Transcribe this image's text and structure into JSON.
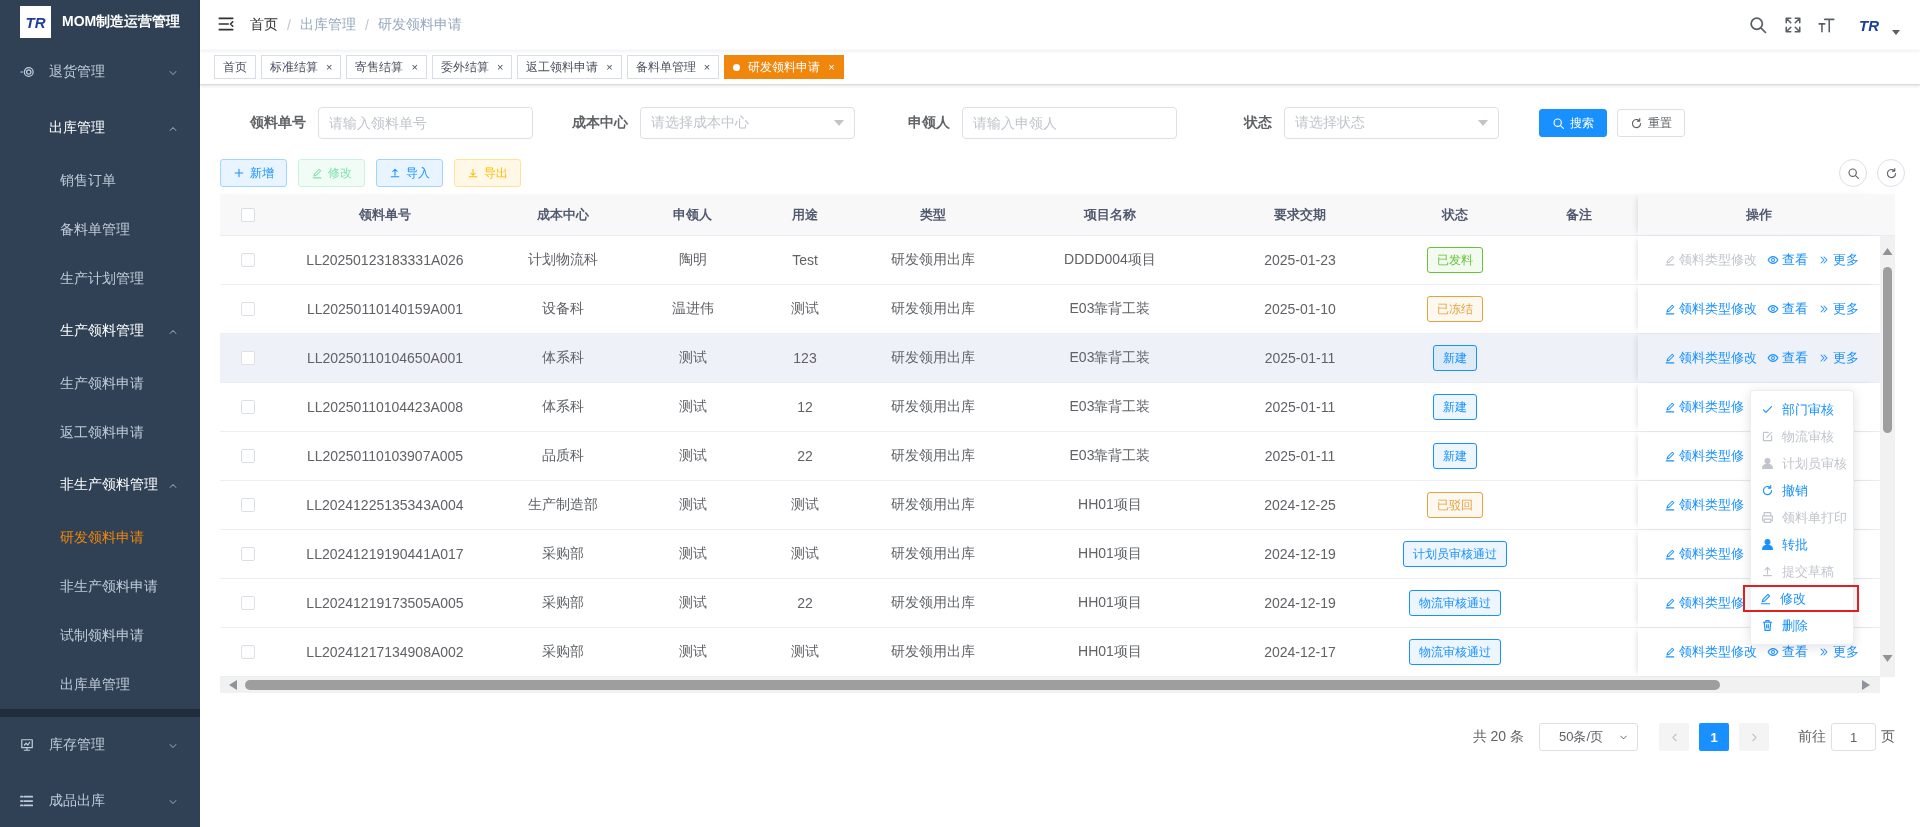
{
  "sidebar": {
    "logo_text": "TR",
    "title": "MOM制造运营管理",
    "items": [
      {
        "label": "退货管理",
        "expanded": false
      },
      {
        "label": "出库管理",
        "expanded": true,
        "children": [
          {
            "label": "销售订单",
            "selected": false
          },
          {
            "label": "备料单管理",
            "selected": false
          },
          {
            "label": "生产计划管理",
            "selected": false
          },
          {
            "label": "生产领料管理",
            "expanded": true,
            "children": [
              {
                "label": "生产领料申请",
                "selected": false
              },
              {
                "label": "返工领料申请",
                "selected": false
              }
            ]
          },
          {
            "label": "非生产领料管理",
            "expanded": true,
            "children": [
              {
                "label": "研发领料申请",
                "selected": true
              },
              {
                "label": "非生产领料申请",
                "selected": false
              },
              {
                "label": "试制领料申请",
                "selected": false
              }
            ]
          },
          {
            "label": "出库单管理",
            "selected": false
          }
        ]
      },
      {
        "label": "库存管理",
        "expanded": false
      },
      {
        "label": "成品出库",
        "expanded": false
      }
    ]
  },
  "header": {
    "breadcrumb": {
      "separator": "/",
      "items": [
        {
          "label": "首页",
          "clickable": true
        },
        {
          "label": "出库管理",
          "clickable": false
        },
        {
          "label": "研发领料申请",
          "clickable": false
        }
      ]
    },
    "avatar_text": "TR"
  },
  "tabs": [
    {
      "label": "首页",
      "selected": false
    },
    {
      "label": "标准结算",
      "selected": false,
      "close_mark": "×"
    },
    {
      "label": "寄售结算",
      "selected": false,
      "close_mark": "×"
    },
    {
      "label": "委外结算",
      "selected": false,
      "close_mark": "×"
    },
    {
      "label": "返工领料申请",
      "selected": false,
      "close_mark": "×"
    },
    {
      "label": "备料单管理",
      "selected": false,
      "close_mark": "×"
    },
    {
      "label": "研发领料申请",
      "selected": true,
      "close_mark": "×"
    }
  ],
  "filters": {
    "fields": [
      {
        "label": "领料单号",
        "placeholder": "请输入领料单号",
        "kind": "input"
      },
      {
        "label": "成本中心",
        "placeholder": "请选择成本中心",
        "kind": "select"
      },
      {
        "label": "申领人",
        "placeholder": "请输入申领人",
        "kind": "input"
      },
      {
        "label": "状态",
        "placeholder": "请选择状态",
        "kind": "select"
      }
    ],
    "buttons": [
      {
        "label": "搜索",
        "kind": "primary"
      },
      {
        "label": "重置",
        "kind": "default"
      }
    ]
  },
  "toolbar": [
    {
      "label": "新增",
      "kind": "primary",
      "disabled": false
    },
    {
      "label": "修改",
      "kind": "success",
      "disabled": true
    },
    {
      "label": "导入",
      "kind": "info",
      "disabled": false
    },
    {
      "label": "导出",
      "kind": "warning",
      "disabled": false
    }
  ],
  "table": {
    "all_checked": false,
    "columns": [
      "领料单号",
      "成本中心",
      "申领人",
      "用途",
      "类型",
      "项目名称",
      "要求交期",
      "状态",
      "备注",
      "操作"
    ],
    "rows": [
      {
        "checked": false,
        "hovered": false,
        "cells": [
          "LL20250123183331A026",
          "计划物流科",
          "陶明",
          "Test",
          "研发领用出库",
          "DDDD004项目",
          "2025-01-23"
        ],
        "status": "已发料",
        "color": "#67c23a",
        "actions": [
          {
            "label": "领料类型修改",
            "disabled": true
          },
          {
            "label": "查看",
            "disabled": false
          },
          {
            "label": "更多",
            "disabled": false
          }
        ]
      },
      {
        "checked": false,
        "hovered": false,
        "cells": [
          "LL20250110140159A001",
          "设备科",
          "温进伟",
          "测试",
          "研发领用出库",
          "E03靠背工装",
          "2025-01-10"
        ],
        "status": "已冻结",
        "color": "#e6a23c",
        "actions": [
          {
            "label": "领料类型修改",
            "disabled": false
          },
          {
            "label": "查看",
            "disabled": false
          },
          {
            "label": "更多",
            "disabled": false
          }
        ]
      },
      {
        "checked": false,
        "hovered": true,
        "cells": [
          "LL20250110104650A001",
          "体系科",
          "测试",
          "123",
          "研发领用出库",
          "E03靠背工装",
          "2025-01-11"
        ],
        "status": "新建",
        "color": "#1890ff",
        "actions": [
          {
            "label": "领料类型修改",
            "disabled": false
          },
          {
            "label": "查看",
            "disabled": false
          },
          {
            "label": "更多",
            "disabled": false
          }
        ]
      },
      {
        "checked": false,
        "hovered": false,
        "cells": [
          "LL20250110104423A008",
          "体系科",
          "测试",
          "12",
          "研发领用出库",
          "E03靠背工装",
          "2025-01-11"
        ],
        "status": "新建",
        "color": "#1890ff",
        "actions": [
          {
            "label": "领料类型修",
            "disabled": false
          }
        ]
      },
      {
        "checked": false,
        "hovered": false,
        "cells": [
          "LL20250110103907A005",
          "品质科",
          "测试",
          "22",
          "研发领用出库",
          "E03靠背工装",
          "2025-01-11"
        ],
        "status": "新建",
        "color": "#1890ff",
        "actions": [
          {
            "label": "领料类型修",
            "disabled": false
          }
        ]
      },
      {
        "checked": false,
        "hovered": false,
        "cells": [
          "LL20241225135343A004",
          "生产制造部",
          "测试",
          "测试",
          "研发领用出库",
          "HH01项目",
          "2024-12-25"
        ],
        "status": "已驳回",
        "color": "#e6a23c",
        "actions": [
          {
            "label": "领料类型修",
            "disabled": false
          }
        ]
      },
      {
        "checked": false,
        "hovered": false,
        "cells": [
          "LL20241219190441A017",
          "采购部",
          "测试",
          "测试",
          "研发领用出库",
          "HH01项目",
          "2024-12-19"
        ],
        "status": "计划员审核通过",
        "color": "#1890ff",
        "actions": [
          {
            "label": "领料类型修",
            "disabled": false
          }
        ]
      },
      {
        "checked": false,
        "hovered": false,
        "cells": [
          "LL20241219173505A005",
          "采购部",
          "测试",
          "22",
          "研发领用出库",
          "HH01项目",
          "2024-12-19"
        ],
        "status": "物流审核通过",
        "color": "#1890ff",
        "actions": [
          {
            "label": "领料类型修",
            "disabled": false
          }
        ]
      },
      {
        "checked": false,
        "hovered": false,
        "cells": [
          "LL20241217134908A002",
          "采购部",
          "测试",
          "测试",
          "研发领用出库",
          "HH01项目",
          "2024-12-17"
        ],
        "status": "物流审核通过",
        "color": "#1890ff",
        "actions": [
          {
            "label": "领料类型修改",
            "disabled": false
          },
          {
            "label": "查看",
            "disabled": false
          },
          {
            "label": "更多",
            "disabled": false
          }
        ]
      }
    ],
    "row_menu": [
      {
        "label": "部门审核",
        "disabled": false,
        "outlined": false
      },
      {
        "label": "物流审核",
        "disabled": true,
        "outlined": false
      },
      {
        "label": "计划员审核",
        "disabled": true,
        "outlined": false
      },
      {
        "label": "撤销",
        "disabled": false,
        "outlined": false
      },
      {
        "label": "领料单打印",
        "disabled": true,
        "outlined": false
      },
      {
        "label": "转批",
        "disabled": false,
        "outlined": false
      },
      {
        "label": "提交草稿",
        "disabled": true,
        "outlined": false
      },
      {
        "label": "修改",
        "disabled": false,
        "outlined": true
      },
      {
        "label": "删除",
        "disabled": false,
        "outlined": false
      }
    ]
  },
  "pagination": {
    "total": "共 20 条",
    "page_size": "50条/页",
    "pages": [
      {
        "label": "1",
        "selected": true
      }
    ],
    "jump_label": "前往",
    "jump_value": "1",
    "jump_suffix": "页"
  }
}
